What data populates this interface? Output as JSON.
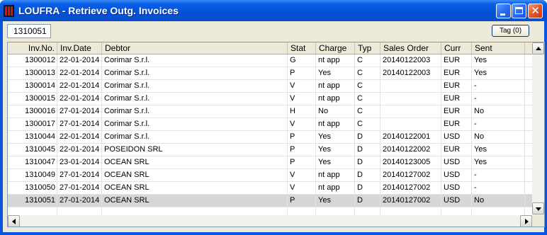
{
  "window": {
    "title": "LOUFRA - Retrieve Outg. Invoices"
  },
  "toolbar": {
    "invoice_field_value": "1310051",
    "tag_button_label": "Tag (0)"
  },
  "columns": [
    "Inv.No.",
    "Inv.Date",
    "Debtor",
    "Stat",
    "Charge",
    "Typ",
    "Sales Order",
    "Curr",
    "Sent"
  ],
  "rows": [
    {
      "inv_no": "1300012",
      "inv_date": "22-01-2014",
      "debtor": "Corimar S.r.l.",
      "stat": "G",
      "charge": "nt app",
      "typ": "C",
      "sales_order": "20140122003",
      "curr": "EUR",
      "sent": "Yes"
    },
    {
      "inv_no": "1300013",
      "inv_date": "22-01-2014",
      "debtor": "Corimar S.r.l.",
      "stat": "P",
      "charge": "Yes",
      "typ": "C",
      "sales_order": "20140122003",
      "curr": "EUR",
      "sent": "Yes"
    },
    {
      "inv_no": "1300014",
      "inv_date": "22-01-2014",
      "debtor": "Corimar S.r.l.",
      "stat": "V",
      "charge": "nt app",
      "typ": "C",
      "sales_order": "",
      "curr": "EUR",
      "sent": "-"
    },
    {
      "inv_no": "1300015",
      "inv_date": "22-01-2014",
      "debtor": "Corimar S.r.l.",
      "stat": "V",
      "charge": "nt app",
      "typ": "C",
      "sales_order": "",
      "curr": "EUR",
      "sent": "-"
    },
    {
      "inv_no": "1300016",
      "inv_date": "27-01-2014",
      "debtor": "Corimar S.r.l.",
      "stat": "H",
      "charge": "No",
      "typ": "C",
      "sales_order": "",
      "curr": "EUR",
      "sent": "No"
    },
    {
      "inv_no": "1300017",
      "inv_date": "27-01-2014",
      "debtor": "Corimar S.r.l.",
      "stat": "V",
      "charge": "nt app",
      "typ": "C",
      "sales_order": "",
      "curr": "EUR",
      "sent": "-"
    },
    {
      "inv_no": "1310044",
      "inv_date": "22-01-2014",
      "debtor": "Corimar S.r.l.",
      "stat": "P",
      "charge": "Yes",
      "typ": "D",
      "sales_order": "20140122001",
      "curr": "USD",
      "sent": "No"
    },
    {
      "inv_no": "1310045",
      "inv_date": "22-01-2014",
      "debtor": "POSEIDON SRL",
      "stat": "P",
      "charge": "Yes",
      "typ": "D",
      "sales_order": "20140122002",
      "curr": "EUR",
      "sent": "Yes"
    },
    {
      "inv_no": "1310047",
      "inv_date": "23-01-2014",
      "debtor": "OCEAN SRL",
      "stat": "P",
      "charge": "Yes",
      "typ": "D",
      "sales_order": "20140123005",
      "curr": "USD",
      "sent": "Yes"
    },
    {
      "inv_no": "1310049",
      "inv_date": "27-01-2014",
      "debtor": "OCEAN SRL",
      "stat": "V",
      "charge": "nt app",
      "typ": "D",
      "sales_order": "20140127002",
      "curr": "USD",
      "sent": "-"
    },
    {
      "inv_no": "1310050",
      "inv_date": "27-01-2014",
      "debtor": "OCEAN SRL",
      "stat": "V",
      "charge": "nt app",
      "typ": "D",
      "sales_order": "20140127002",
      "curr": "USD",
      "sent": "-"
    },
    {
      "inv_no": "1310051",
      "inv_date": "27-01-2014",
      "debtor": "OCEAN SRL",
      "stat": "P",
      "charge": "Yes",
      "typ": "D",
      "sales_order": "20140127002",
      "curr": "USD",
      "sent": "No",
      "selected": true
    }
  ],
  "colors": {
    "titlebar": "#0a55e0",
    "selected_row": "#d6d6d6",
    "close_button": "#e05a2a"
  },
  "icons": {
    "app": "app-logo-icon",
    "minimize": "minimize-icon",
    "maximize": "maximize-icon",
    "close": "close-icon",
    "scroll_up": "arrow-up-icon",
    "scroll_down": "arrow-down-icon",
    "scroll_left": "arrow-left-icon",
    "scroll_right": "arrow-right-icon"
  }
}
